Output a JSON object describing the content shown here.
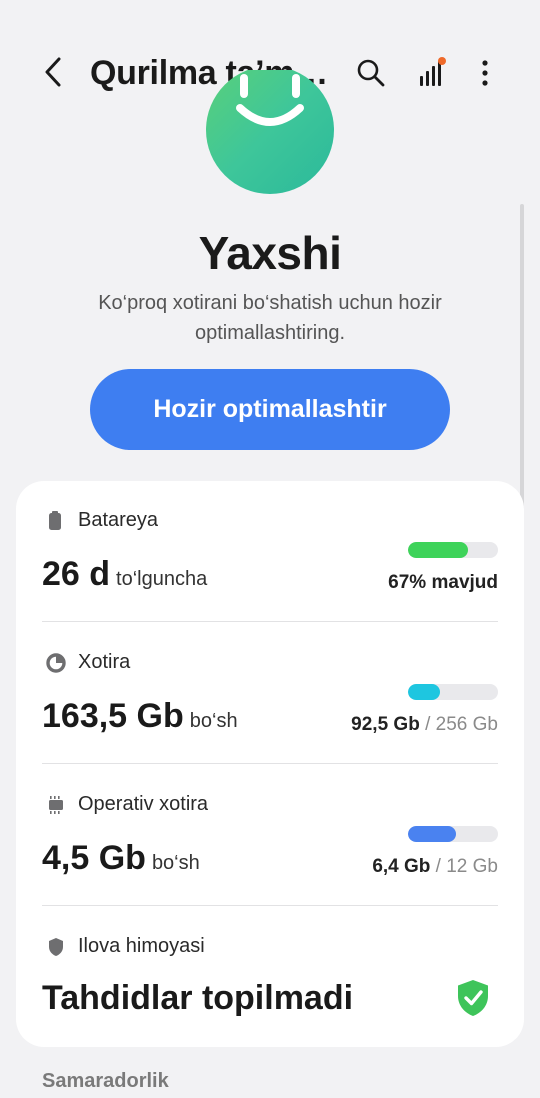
{
  "header": {
    "title": "Qurilma ta’m…",
    "icons": [
      "back-icon",
      "search-icon",
      "signal-notification-icon",
      "more-vert-icon"
    ]
  },
  "status": {
    "face_icon": "smiley-face-icon",
    "title": "Yaxshi",
    "description": "Ko‘proq xotirani bo‘shatish uchun hozir optimallashtiring.",
    "button_label": "Hozir optimallashtir"
  },
  "battery": {
    "label": "Batareya",
    "icon": "battery-icon",
    "value": "26 d",
    "unit": "to‘lguncha",
    "level_percent": 67,
    "right_text": "67% mavjud",
    "color": "#3ed35a"
  },
  "storage": {
    "label": "Xotira",
    "icon": "pie-chart-icon",
    "value": "163,5 Gb",
    "unit": "bo‘sh",
    "used": "92,5 Gb",
    "separator": " / ",
    "total": "256 Gb",
    "level_percent": 36,
    "color": "#1ec6e0"
  },
  "ram": {
    "label": "Operativ xotira",
    "icon": "memory-chip-icon",
    "value": "4,5 Gb",
    "unit": "bo‘sh",
    "used": "6,4 Gb",
    "separator": " / ",
    "total": "12 Gb",
    "level_percent": 53,
    "color": "#4a82f0"
  },
  "protection": {
    "label": "Ilova himoyasi",
    "icon": "shield-icon",
    "value": "Tahdidlar topilmadi",
    "status_icon": "shield-check-icon",
    "color": "#3ec45a"
  },
  "performance": {
    "label": "Samaradorlik"
  }
}
